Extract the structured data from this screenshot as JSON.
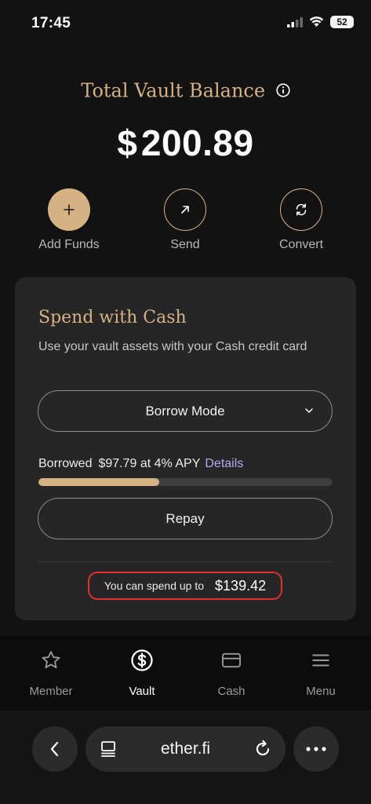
{
  "status_bar": {
    "time": "17:45",
    "battery": "52"
  },
  "balance": {
    "title": "Total Vault Balance",
    "currency": "$",
    "amount": "200.89"
  },
  "actions": [
    {
      "label": "Add Funds",
      "icon": "plus-icon"
    },
    {
      "label": "Send",
      "icon": "arrow-up-right-icon"
    },
    {
      "label": "Convert",
      "icon": "convert-arrows-icon"
    }
  ],
  "spend_card": {
    "title": "Spend with Cash",
    "description": "Use your vault assets with your Cash credit card",
    "mode": "Borrow Mode",
    "borrowed_label": "Borrowed",
    "borrowed_amount": "$97.79 at 4% APY",
    "details_label": "Details",
    "borrow_utilization": 0.41,
    "repay_label": "Repay",
    "spend_label": "You can spend up to",
    "spend_value": "$139.42"
  },
  "bottom_nav": {
    "active": "Vault",
    "items": [
      {
        "label": "Member",
        "icon": "star-icon"
      },
      {
        "label": "Vault",
        "icon": "dollar-circle-icon"
      },
      {
        "label": "Cash",
        "icon": "credit-card-icon"
      },
      {
        "label": "Menu",
        "icon": "hamburger-menu-icon"
      }
    ]
  },
  "browser": {
    "url": "ether.fi"
  },
  "colors": {
    "accent": "#d5b283",
    "link": "#b7a7f0",
    "highlight": "#e0312b",
    "card": "#272626",
    "background": "#131212"
  }
}
